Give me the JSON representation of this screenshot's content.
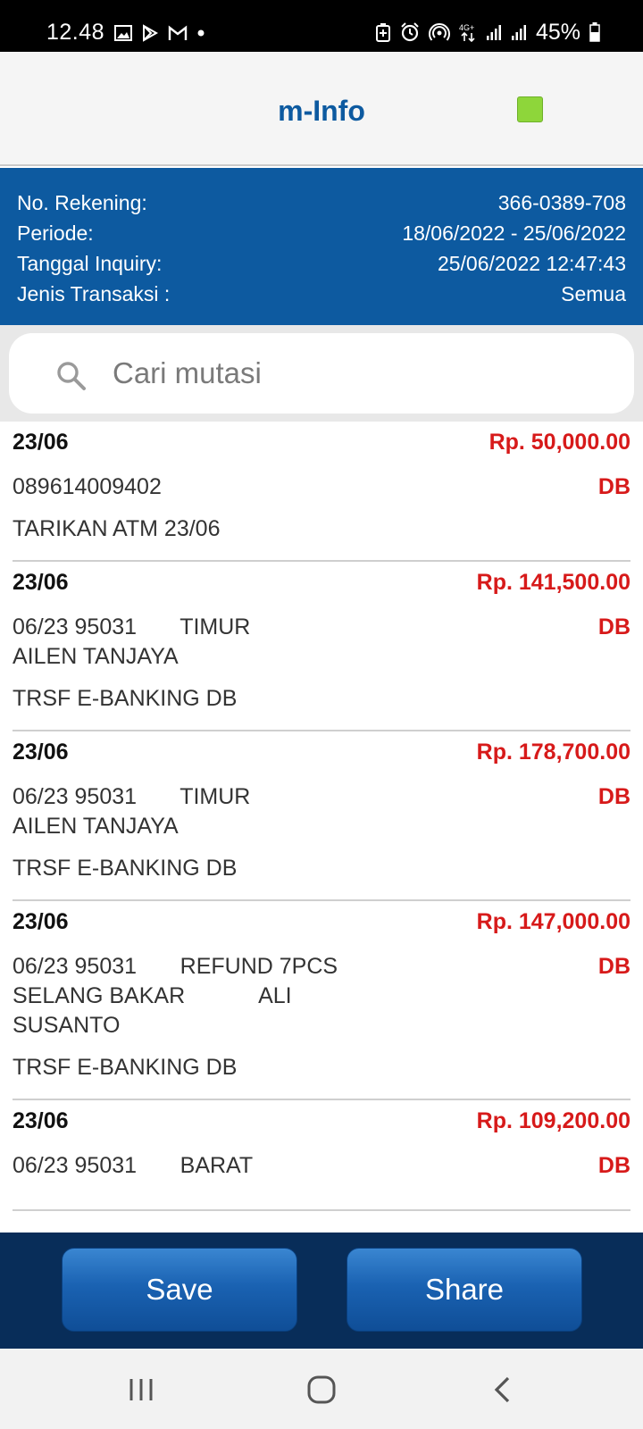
{
  "status_bar": {
    "time": "12.48",
    "battery": "45%",
    "network": "4G+",
    "left_icons": [
      "image-icon",
      "play-store-icon",
      "gmail-icon",
      "dot-icon"
    ],
    "right_icons": [
      "battery-saver-icon",
      "alarm-icon",
      "hotspot-icon",
      "network-4g-icon",
      "signal-icon",
      "signal-icon",
      "battery-icon"
    ]
  },
  "header": {
    "title": "m-Info",
    "indicator_color": "#8ed63a"
  },
  "info": {
    "rows": [
      {
        "label": "No. Rekening:",
        "value": "366-0389-708"
      },
      {
        "label": "Periode:",
        "value": "18/06/2022 - 25/06/2022"
      },
      {
        "label": "Tanggal Inquiry:",
        "value": "25/06/2022 12:47:43"
      },
      {
        "label": "Jenis Transaksi :",
        "value": "Semua"
      }
    ]
  },
  "search": {
    "placeholder": "Cari mutasi"
  },
  "transactions": [
    {
      "date": "23/06",
      "amount": "Rp. 50,000.00",
      "type": "DB",
      "description": "089614009402",
      "note": "TARIKAN ATM 23/06"
    },
    {
      "date": "23/06",
      "amount": "Rp. 141,500.00",
      "type": "DB",
      "description": "06/23 95031       TIMUR\nAILEN TANJAYA",
      "note": "TRSF E-BANKING DB"
    },
    {
      "date": "23/06",
      "amount": "Rp. 178,700.00",
      "type": "DB",
      "description": "06/23 95031       TIMUR\nAILEN TANJAYA",
      "note": "TRSF E-BANKING DB"
    },
    {
      "date": "23/06",
      "amount": "Rp. 147,000.00",
      "type": "DB",
      "description": "06/23 95031       REFUND 7PCS\nSELANG BAKAR            ALI\nSUSANTO",
      "note": "TRSF E-BANKING DB"
    },
    {
      "date": "23/06",
      "amount": "Rp. 109,200.00",
      "type": "DB",
      "description": "06/23 95031       BARAT",
      "note": ""
    }
  ],
  "actions": {
    "save_label": "Save",
    "share_label": "Share"
  },
  "colors": {
    "brand_blue": "#0d5aa0",
    "debit_red": "#d71a1a",
    "action_bar": "#082d59"
  }
}
